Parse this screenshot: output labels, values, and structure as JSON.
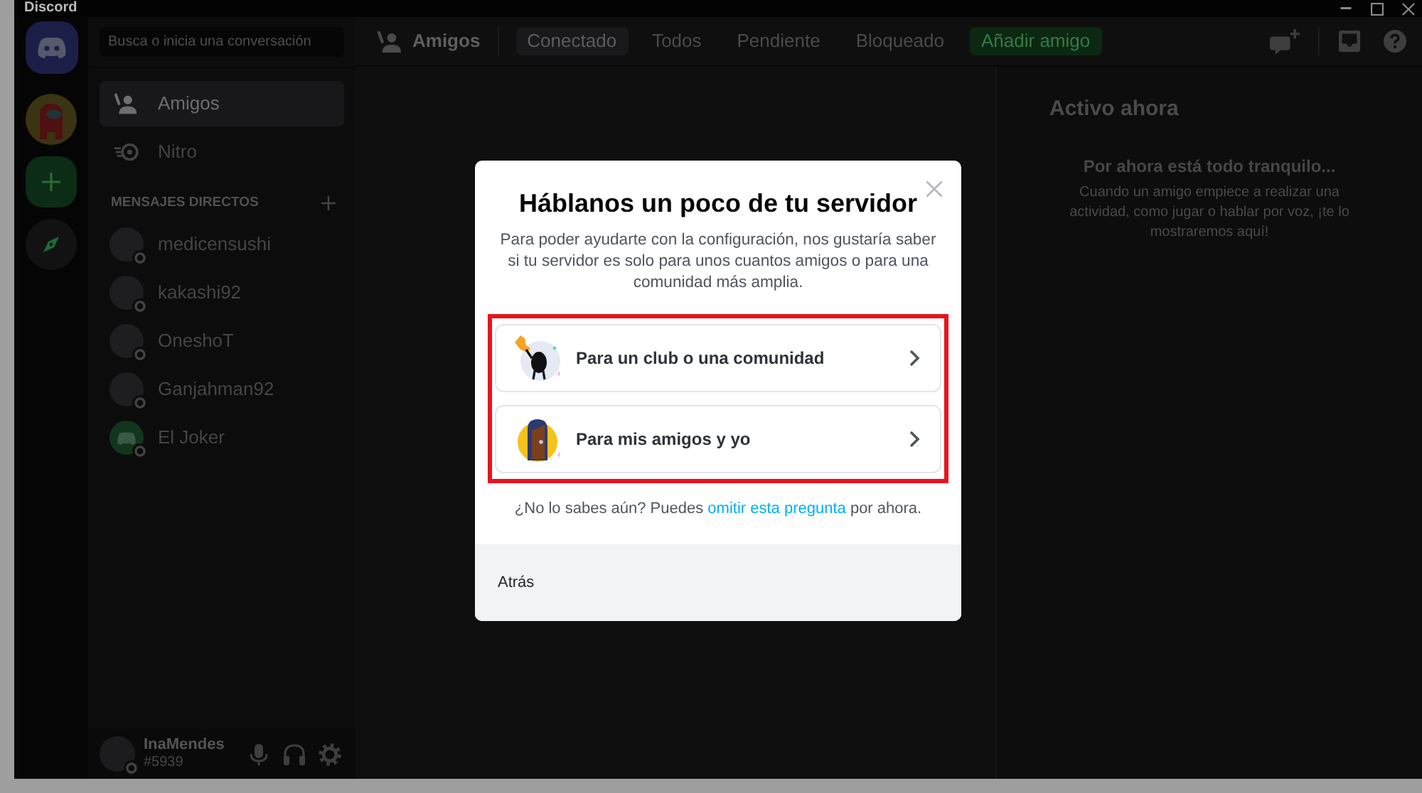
{
  "window": {
    "title": "Discord"
  },
  "server_rail": [
    {
      "kind": "home"
    },
    {
      "kind": "server"
    },
    {
      "kind": "add"
    },
    {
      "kind": "explore"
    }
  ],
  "search": {
    "placeholder": "Busca o inicia una conversación"
  },
  "sidebar": {
    "items": [
      {
        "kind": "friends",
        "label": "Amigos",
        "selected": true
      },
      {
        "kind": "nitro",
        "label": "Nitro",
        "selected": false
      }
    ],
    "section_title": "MENSAJES DIRECTOS",
    "direct_messages": [
      {
        "name": "medicensushi",
        "kind": "photo",
        "online": false
      },
      {
        "name": "kakashi92",
        "kind": "photo",
        "online": false
      },
      {
        "name": "OneshoT",
        "kind": "photo",
        "online": false
      },
      {
        "name": "Ganjahman92",
        "kind": "photo",
        "online": false
      },
      {
        "name": "El Joker",
        "kind": "default",
        "online": false
      }
    ]
  },
  "user_panel": {
    "username": "InaMendes",
    "tag": "#5939",
    "online": false
  },
  "header": {
    "title": "Amigos",
    "tabs": [
      {
        "label": "Conectado",
        "selected": true
      },
      {
        "label": "Todos",
        "selected": false
      },
      {
        "label": "Pendiente",
        "selected": false
      },
      {
        "label": "Bloqueado",
        "selected": false
      }
    ],
    "add_friend": "Añadir amigo"
  },
  "active_now": {
    "title": "Activo ahora",
    "empty_title": "Por ahora está todo tranquilo...",
    "empty_text": "Cuando un amigo empiece a realizar una actividad, como jugar o hablar por voz, ¡te lo mostraremos aquí!"
  },
  "modal": {
    "title": "Háblanos un poco de tu servidor",
    "description": "Para poder ayudarte con la configuración, nos gustaría saber si tu servidor es solo para unos cuantos amigos o para una comunidad más amplia.",
    "highlighted": true,
    "options": [
      {
        "kind": "community",
        "label": "Para un club o una comunidad"
      },
      {
        "kind": "friends",
        "label": "Para mis amigos y yo"
      }
    ],
    "hint_before": "¿No lo sabes aún? Puedes ",
    "hint_link": "omitir esta pregunta",
    "hint_after": " por ahora.",
    "back_button": "Atrás"
  }
}
